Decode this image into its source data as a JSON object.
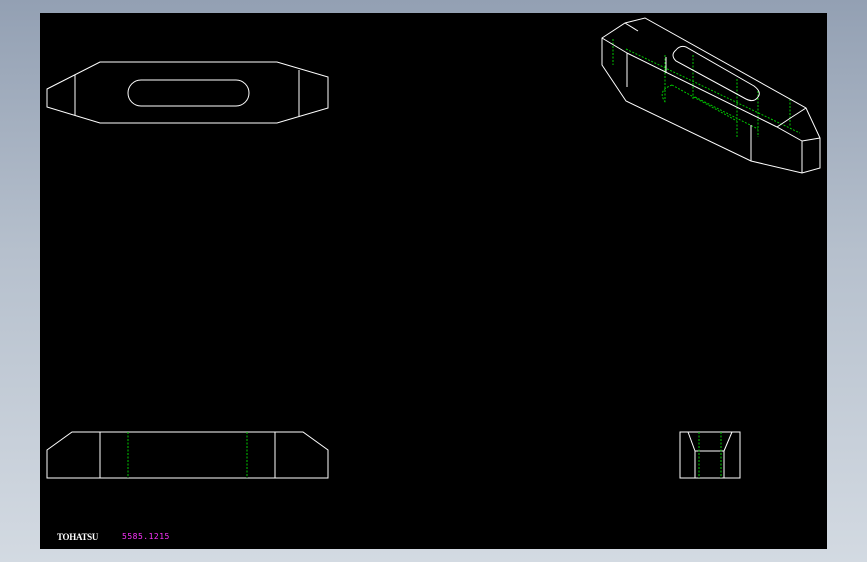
{
  "drawing": {
    "brand": "TOHATSU",
    "part_number": "5585.1215",
    "colors": {
      "background": "#000000",
      "outline": "#ffffff",
      "hidden": "#00c800",
      "part_number": "#ff33ff"
    }
  }
}
